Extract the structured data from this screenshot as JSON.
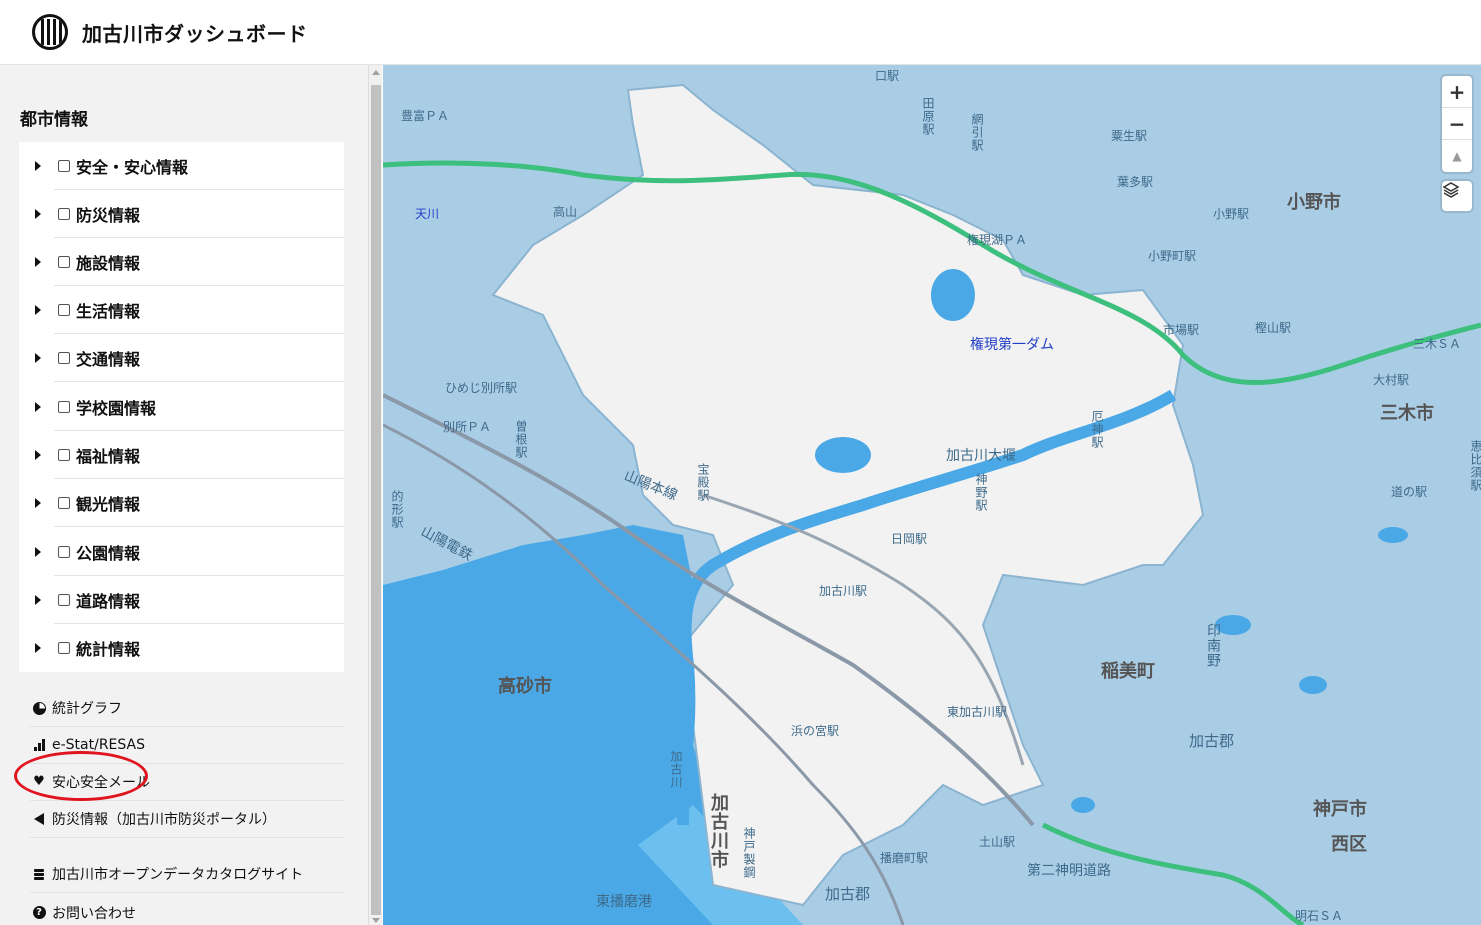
{
  "header": {
    "title": "加古川市ダッシュボード"
  },
  "sidebar": {
    "section_title": "都市情報",
    "tree_items": [
      {
        "label": "安全・安心情報"
      },
      {
        "label": "防災情報"
      },
      {
        "label": "施設情報"
      },
      {
        "label": "生活情報"
      },
      {
        "label": "交通情報"
      },
      {
        "label": "学校園情報"
      },
      {
        "label": "福祉情報"
      },
      {
        "label": "観光情報"
      },
      {
        "label": "公園情報"
      },
      {
        "label": "道路情報"
      },
      {
        "label": "統計情報"
      }
    ],
    "links": [
      {
        "label": "統計グラフ",
        "icon": "pie-chart-icon"
      },
      {
        "label": "e-Stat/RESAS",
        "icon": "bar-chart-icon"
      },
      {
        "label": "安心安全メール",
        "icon": "heart-icon"
      },
      {
        "label": "防災情報（加古川市防災ポータル）",
        "icon": "megaphone-icon"
      },
      {
        "label": "加古川市オープンデータカタログサイト",
        "icon": "database-icon"
      },
      {
        "label": "お問い合わせ",
        "icon": "question-icon"
      }
    ]
  },
  "map": {
    "controls": {
      "zoom_in": "+",
      "zoom_out": "−",
      "compass": "▲"
    },
    "labels": {
      "ono_city": "小野市",
      "miki_city": "三木市",
      "inami_town": "稲美町",
      "takasago_city": "高砂市",
      "kakogawa_city": "加古川市",
      "kobe_nishi_1": "神戸市",
      "kobe_nishi_2": "西区",
      "kako_gun": "加古郡",
      "kako_gun2": "加古郡",
      "gongen_dam": "権現第一ダム",
      "kakogawa_ozeki": "加古川大堰",
      "kakogawa_station": "加古川駅",
      "higashi_kakogawa": "東加古川駅",
      "hama_no_miya": "浜の宮駅",
      "hioka_station": "日岡駅",
      "hokota": "宝殿駅",
      "kanno": "神野駅",
      "yakujin": "厄神駅",
      "toban_port": "東播磨港",
      "sanyo_line": "山陽本線",
      "sanyo_dentetsu": "山陽電鉄",
      "daini_shinmei": "第二神明道路",
      "kobe_steel": "神戸製鋼",
      "kakogawa_river": "加古川",
      "tenkawa": "天川",
      "takayama": "高山",
      "himeji_bessho": "ひめじ別所駅",
      "bessho_pa": "別所ＰＡ",
      "sone": "曽根駅",
      "matogata": "的形駅",
      "toyotomi_pa": "豊富ＰＡ",
      "gongen_pa": "権現湖ＰＡ",
      "kurisu": "粟生駅",
      "hatakeda": "葉多駅",
      "ono_station": "小野駅",
      "ono_machi": "小野町駅",
      "ichiba": "市場駅",
      "kashihara": "樫山駅",
      "miki_sa": "三木ＳＡ",
      "omura": "大村駅",
      "michinoeki": "道の駅",
      "inamino": "印南野",
      "tsuchiyama": "土山駅",
      "harima_cho": "播磨町駅",
      "meiji_sa": "明石ＳＡ",
      "kakosan_gun": "加古郡",
      "tawara": "田原駅",
      "amibiki": "網引駅",
      "kuchi": "口駅",
      "ebisu": "恵比須駅"
    }
  }
}
